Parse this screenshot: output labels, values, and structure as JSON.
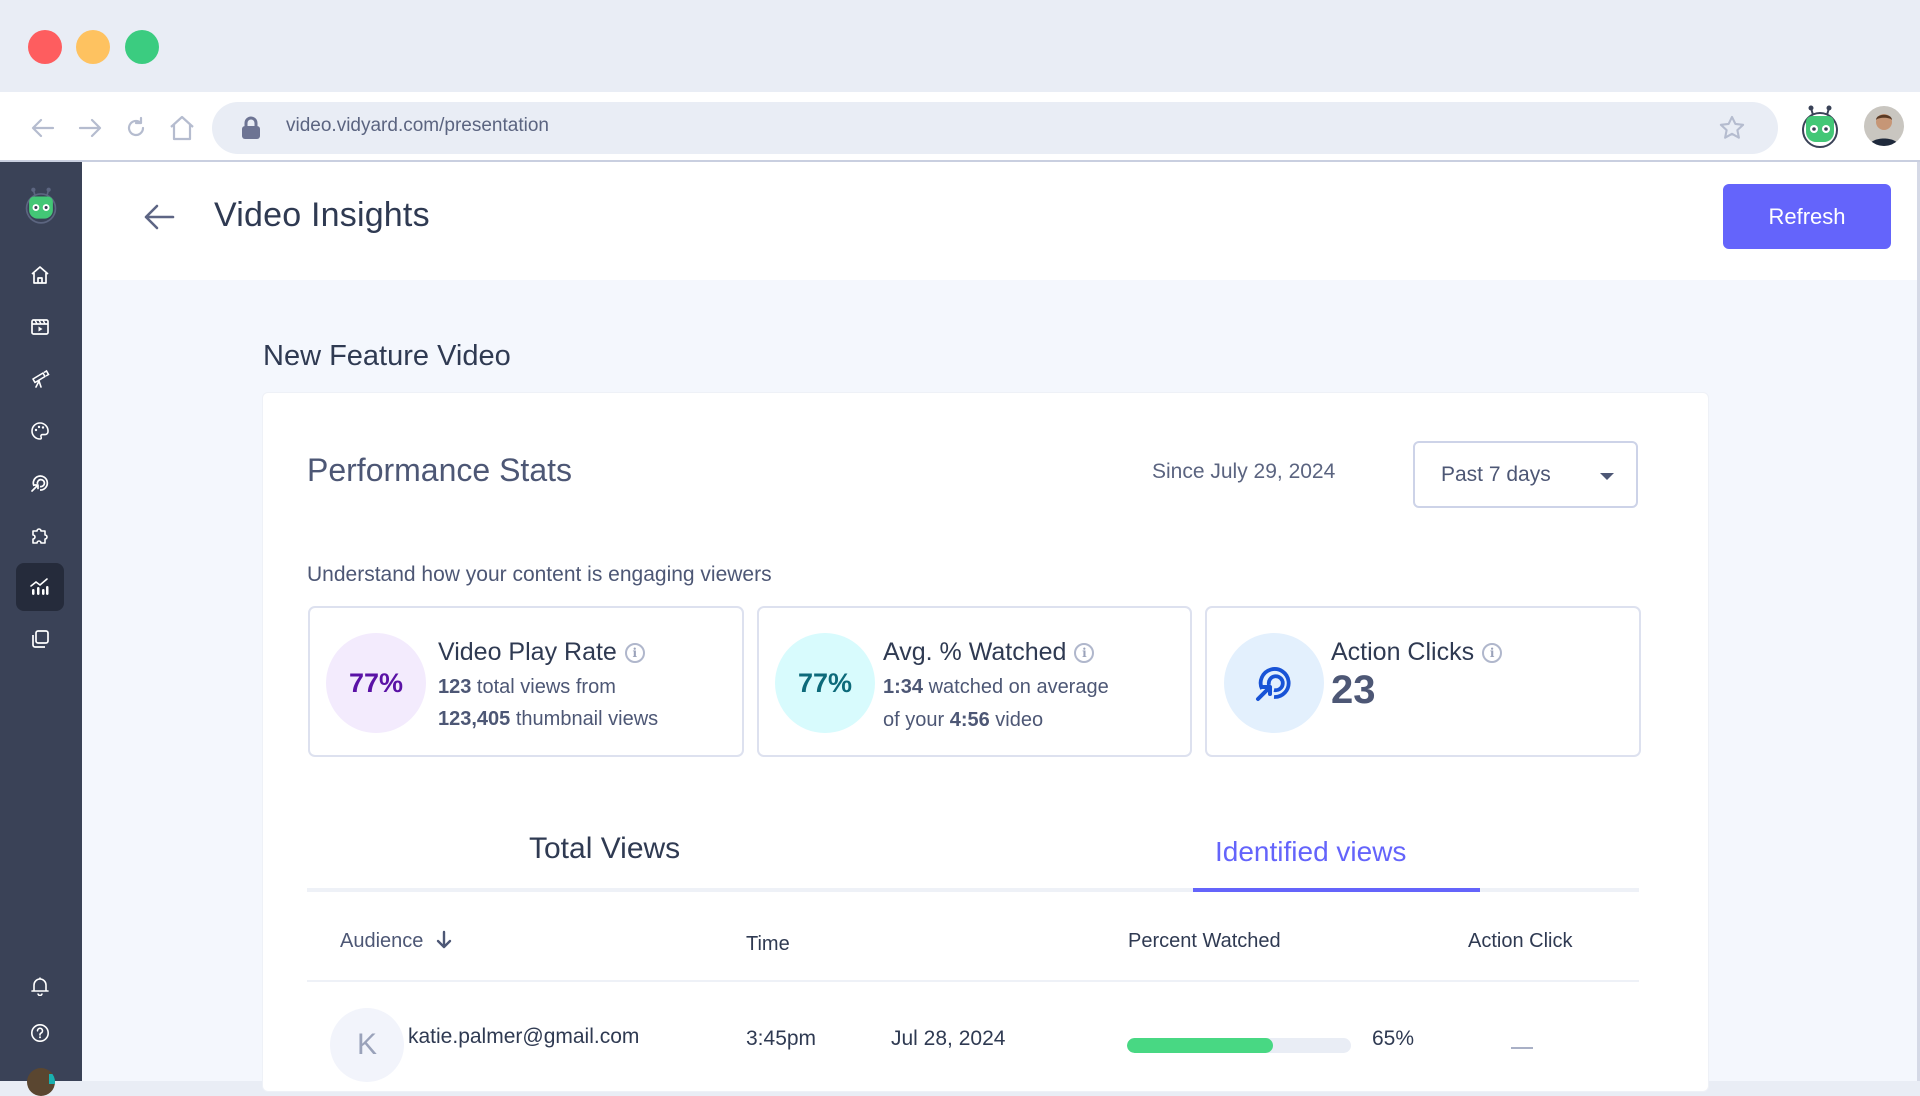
{
  "browser": {
    "traffic_lights": {
      "close": "#fe5d5f",
      "minimize": "#fec260",
      "maximize": "#3bcc80"
    },
    "nav": [
      "back-arrow-icon",
      "forward-arrow-icon",
      "reload-icon",
      "home-icon"
    ],
    "url": "video.vidyard.com/presentation",
    "lock_icon": "lock-icon",
    "bookmark_icon": "star-icon",
    "extension_icon": "vidyard-robot-icon",
    "profile_avatar": "user-avatar"
  },
  "sidebar": {
    "logo": "vidyard-robot-logo",
    "items": [
      {
        "name": "home",
        "icon": "home-icon"
      },
      {
        "name": "videos",
        "icon": "clapperboard-icon"
      },
      {
        "name": "discover",
        "icon": "telescope-icon"
      },
      {
        "name": "branding",
        "icon": "palette-icon"
      },
      {
        "name": "actions",
        "icon": "target-cursor-icon"
      },
      {
        "name": "integrations",
        "icon": "puzzle-icon"
      },
      {
        "name": "analytics",
        "icon": "analytics-icon",
        "active": true
      },
      {
        "name": "library",
        "icon": "copy-icon"
      }
    ],
    "bottom": [
      {
        "name": "notifications",
        "icon": "bell-icon"
      },
      {
        "name": "help",
        "icon": "help-circle-icon"
      }
    ]
  },
  "header": {
    "title": "Video Insights",
    "refresh_label": "Refresh"
  },
  "video": {
    "title": "New Feature Video"
  },
  "performance": {
    "title": "Performance Stats",
    "since": "Since July 29, 2024",
    "range_selected": "Past 7 days",
    "subtitle": "Understand how your content is engaging viewers",
    "stats": [
      {
        "title": "Video Play Rate",
        "value": "77%",
        "line1_bold": "123",
        "line1_rest": " total views from",
        "line2_bold": "123,405",
        "line2_rest": " thumbnail views"
      },
      {
        "title": "Avg. % Watched",
        "value": "77%",
        "line1_bold": "1:34",
        "line1_rest": " watched on average",
        "line2_pre": "of your ",
        "line2_bold": "4:56",
        "line2_rest": " video"
      },
      {
        "title": "Action Clicks",
        "value": "23"
      }
    ]
  },
  "tabs": [
    {
      "label": "Total Views",
      "active": false
    },
    {
      "label": "Identified views",
      "active": true
    }
  ],
  "table": {
    "columns": [
      "Audience",
      "Time",
      "Percent Watched",
      "Action Click"
    ],
    "rows": [
      {
        "initial": "K",
        "email": "katie.palmer@gmail.com",
        "time": "3:45pm",
        "date": "Jul 28, 2024",
        "percent_watched": 65,
        "percent_label": "65%",
        "action_click": "—"
      }
    ]
  },
  "colors": {
    "accent": "#6464fb",
    "sidebar": "#3a4257",
    "progress": "#48d883",
    "play_rate_bg": "#f3ebfd",
    "play_rate_text": "#5a12a6",
    "watched_bg": "#d8fbfd",
    "watched_text": "#0d6a7a",
    "action_bg": "#e3f0fd",
    "action_icon": "#1853d6"
  }
}
